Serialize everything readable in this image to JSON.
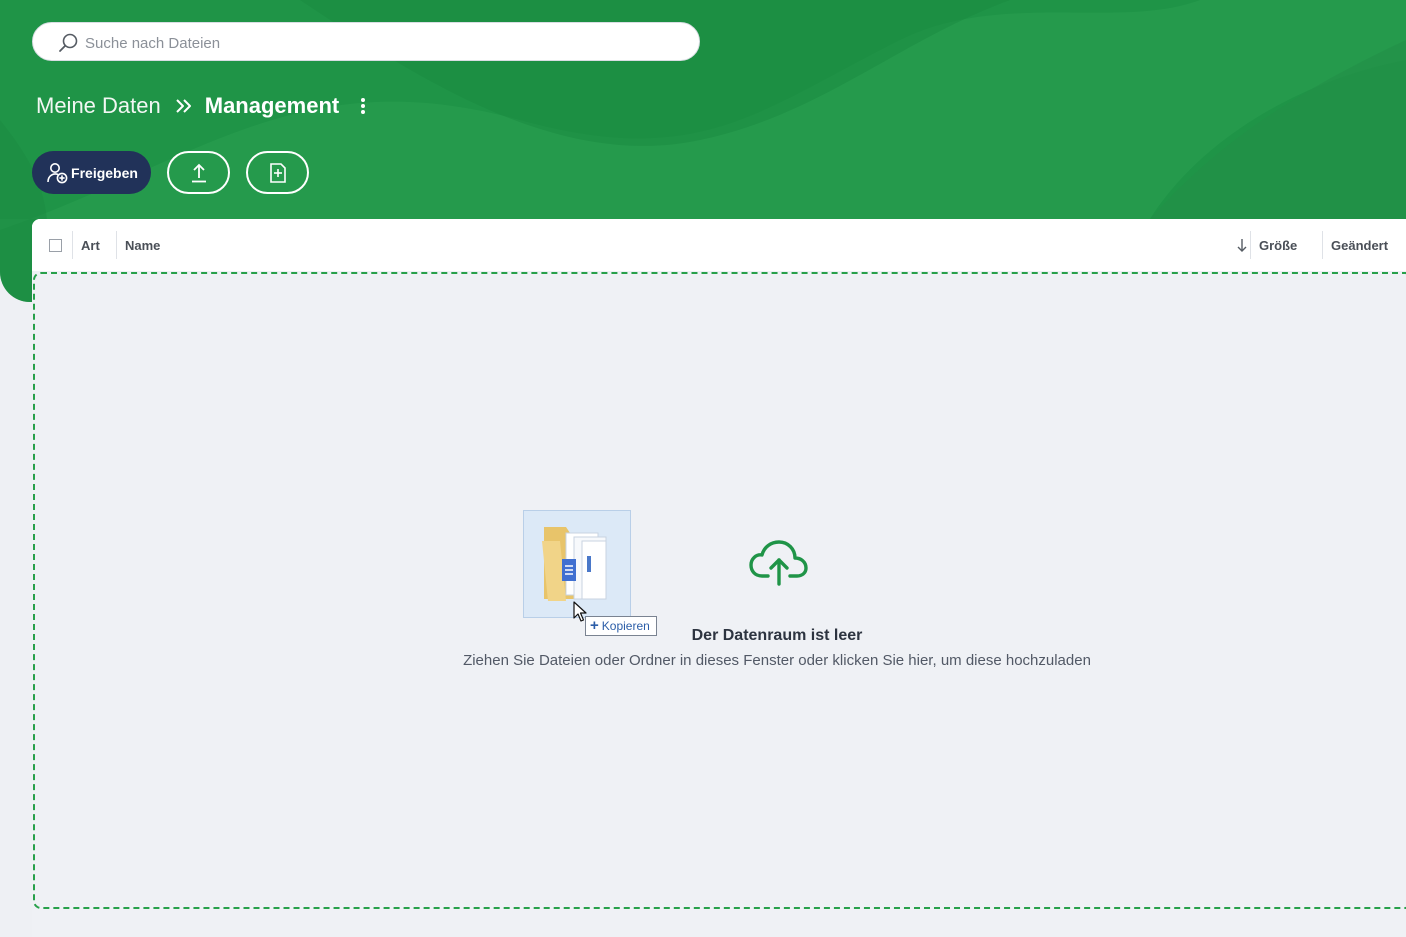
{
  "search": {
    "placeholder": "Suche nach Dateien"
  },
  "breadcrumb": {
    "root": "Meine Daten",
    "current": "Management"
  },
  "toolbar": {
    "share_label": "Freigeben"
  },
  "table": {
    "columns": {
      "type": "Art",
      "name": "Name",
      "size": "Größe",
      "modified": "Geändert"
    }
  },
  "dropzone": {
    "title": "Der Datenraum ist leer",
    "subtitle": "Ziehen Sie Dateien oder Ordner in dieses Fenster oder klicken Sie hier, um diese hochzuladen",
    "drag_tooltip": "Kopieren"
  },
  "colors": {
    "header_green": "#1f9447",
    "share_button": "#213259",
    "dropzone_border": "#27a04a"
  },
  "icons": [
    "search-icon",
    "chevrons-right-icon",
    "more-vertical-icon",
    "add-user-icon",
    "upload-icon",
    "new-file-icon",
    "sort-down-icon",
    "cloud-upload-icon",
    "folder-icon",
    "cursor-icon",
    "plus-icon"
  ]
}
